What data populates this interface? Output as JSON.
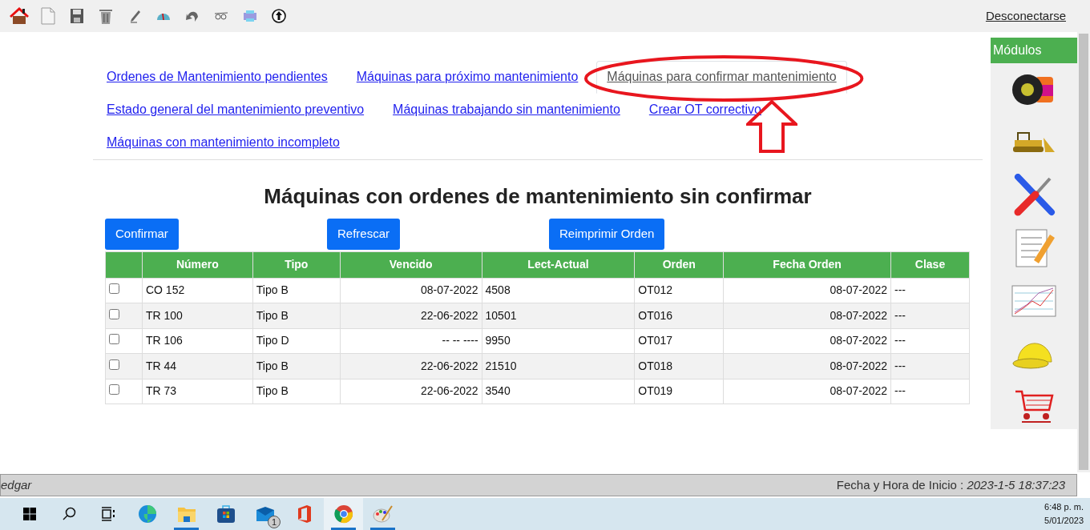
{
  "toolbar": {
    "icons": [
      {
        "kind": "home"
      },
      {
        "kind": "new"
      },
      {
        "kind": "save"
      },
      {
        "kind": "delete"
      },
      {
        "kind": "edit"
      },
      {
        "kind": "gauge"
      },
      {
        "kind": "undo"
      },
      {
        "kind": "glasses"
      },
      {
        "kind": "printer"
      },
      {
        "kind": "upload"
      }
    ],
    "logout": "Desconectarse"
  },
  "tabs": [
    {
      "label": "Ordenes de Mantenimiento pendientes",
      "selected": false
    },
    {
      "label": "Máquinas para próximo mantenimiento",
      "selected": false
    },
    {
      "label": "Máquinas para confirmar mantenimiento",
      "selected": true
    },
    {
      "label": "Estado general del mantenimiento preventivo",
      "selected": false
    },
    {
      "label": "Máquinas trabajando sin mantenimiento",
      "selected": false
    },
    {
      "label": "Crear OT correctivo",
      "selected": false
    },
    {
      "label": "Máquinas con mantenimiento incompleto",
      "selected": false
    }
  ],
  "heading": "Máquinas con ordenes de mantenimiento sin confirmar",
  "buttons": [
    "Confirmar",
    "Refrescar",
    "Reimprimir Orden"
  ],
  "table": {
    "columns": [
      "Número",
      "Tipo",
      "Vencido",
      "Lect-Actual",
      "Orden",
      "Fecha Orden",
      "Clase"
    ],
    "rows": [
      {
        "checked": false,
        "cells": [
          "CO 152",
          "Tipo B",
          "08-07-2022",
          "4508",
          "OT012",
          "08-07-2022",
          "---"
        ]
      },
      {
        "checked": false,
        "cells": [
          "TR 100",
          "Tipo B",
          "22-06-2022",
          "10501",
          "OT016",
          "08-07-2022",
          "---"
        ]
      },
      {
        "checked": false,
        "cells": [
          "TR 106",
          "Tipo D",
          "-- -- ----",
          "9950",
          "OT017",
          "08-07-2022",
          "---"
        ]
      },
      {
        "checked": false,
        "cells": [
          "TR 44",
          "Tipo B",
          "22-06-2022",
          "21510",
          "OT018",
          "08-07-2022",
          "---"
        ]
      },
      {
        "checked": false,
        "cells": [
          "TR 73",
          "Tipo B",
          "22-06-2022",
          "3540",
          "OT019",
          "08-07-2022",
          "---"
        ]
      }
    ]
  },
  "sidebar": {
    "title": "Módulos",
    "items": [
      {
        "kind": "tire"
      },
      {
        "kind": "bulldozer"
      },
      {
        "kind": "tools"
      },
      {
        "kind": "notepad"
      },
      {
        "kind": "chart"
      },
      {
        "kind": "helmet"
      },
      {
        "kind": "cart"
      }
    ]
  },
  "status_bar": {
    "user": "edgar",
    "start_label": "Fecha y Hora de Inicio : ",
    "start_value": "2023-1-5 18:37:23"
  },
  "taskbar": {
    "icons": [
      {
        "kind": "windows",
        "running": false,
        "active": false
      },
      {
        "kind": "search",
        "running": false,
        "active": false
      },
      {
        "kind": "taskview",
        "running": false,
        "active": false
      },
      {
        "kind": "edge",
        "running": false,
        "active": false
      },
      {
        "kind": "folder",
        "running": true,
        "active": false
      },
      {
        "kind": "store",
        "running": false,
        "active": false
      },
      {
        "kind": "mail",
        "running": false,
        "active": false,
        "badge": "1"
      },
      {
        "kind": "office",
        "running": false,
        "active": false
      },
      {
        "kind": "chrome",
        "running": true,
        "active": true
      },
      {
        "kind": "paint",
        "running": true,
        "active": false
      }
    ],
    "time": "6:48 p. m.",
    "date": "5/01/2023"
  }
}
